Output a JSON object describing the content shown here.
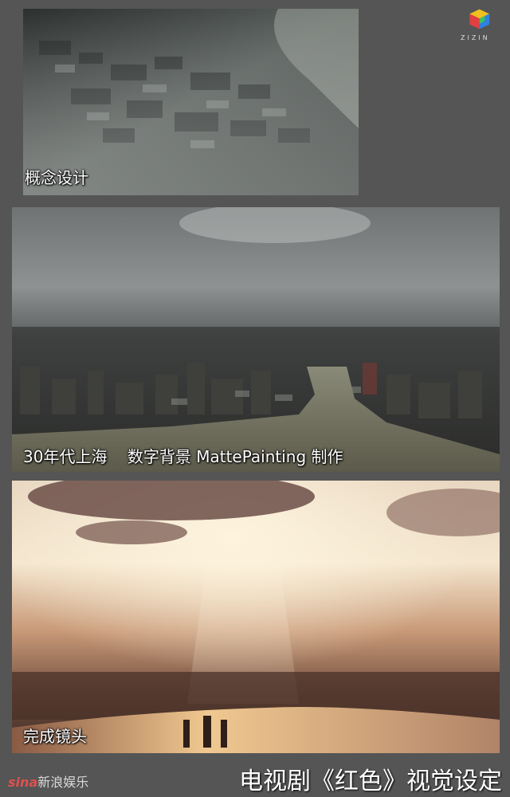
{
  "panels": [
    {
      "caption": "概念设计"
    },
    {
      "caption": "30年代上海    数字背景 MattePainting 制作"
    },
    {
      "caption": "完成镜头"
    }
  ],
  "logo": {
    "text": "ZIZIN",
    "icon": "cube-logo-icon"
  },
  "watermark": {
    "brand": "sina",
    "text": "新浪娱乐"
  },
  "footer": {
    "title": "电视剧《红色》视觉设定"
  }
}
